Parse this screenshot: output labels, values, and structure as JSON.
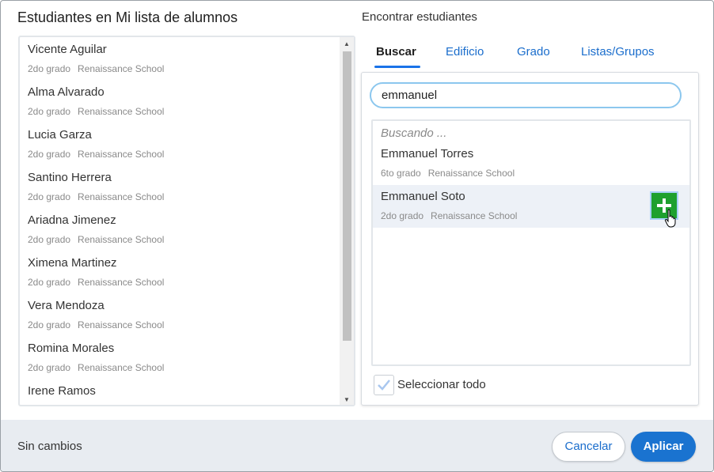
{
  "dialog": {
    "title": "Estudiantes en Mi lista de alumnos",
    "find_label": "Encontrar estudiantes"
  },
  "my_list": [
    {
      "name": "Vicente Aguilar",
      "grade": "2do grado",
      "school": "Renaissance School"
    },
    {
      "name": "Alma Alvarado",
      "grade": "2do grado",
      "school": "Renaissance School"
    },
    {
      "name": "Lucia Garza",
      "grade": "2do grado",
      "school": "Renaissance School"
    },
    {
      "name": "Santino Herrera",
      "grade": "2do grado",
      "school": "Renaissance School"
    },
    {
      "name": "Ariadna Jimenez",
      "grade": "2do grado",
      "school": "Renaissance School"
    },
    {
      "name": "Ximena Martinez",
      "grade": "2do grado",
      "school": "Renaissance School"
    },
    {
      "name": "Vera Mendoza",
      "grade": "2do grado",
      "school": "Renaissance School"
    },
    {
      "name": "Romina Morales",
      "grade": "2do grado",
      "school": "Renaissance School"
    },
    {
      "name": "Irene Ramos",
      "grade": "",
      "school": ""
    }
  ],
  "tabs": [
    {
      "label": "Buscar",
      "active": true
    },
    {
      "label": "Edificio",
      "active": false
    },
    {
      "label": "Grado",
      "active": false
    },
    {
      "label": "Listas/Grupos",
      "active": false
    }
  ],
  "search": {
    "value": "emmanuel",
    "status": "Buscando ..."
  },
  "results": [
    {
      "name": "Emmanuel Torres",
      "grade": "6to grado",
      "school": "Renaissance School"
    },
    {
      "name": "Emmanuel Soto",
      "grade": "2do grado",
      "school": "Renaissance School"
    }
  ],
  "select_all": {
    "label": "Seleccionar todo"
  },
  "footer": {
    "status": "Sin cambios",
    "cancel_label": "Cancelar",
    "apply_label": "Aplicar"
  },
  "colors": {
    "accent": "#1a73d0",
    "add_button": "#1ea02e"
  },
  "icons": [
    "plus-icon",
    "hand-cursor-icon",
    "checkmark-icon",
    "scroll-up-arrow-icon",
    "scroll-down-arrow-icon"
  ]
}
